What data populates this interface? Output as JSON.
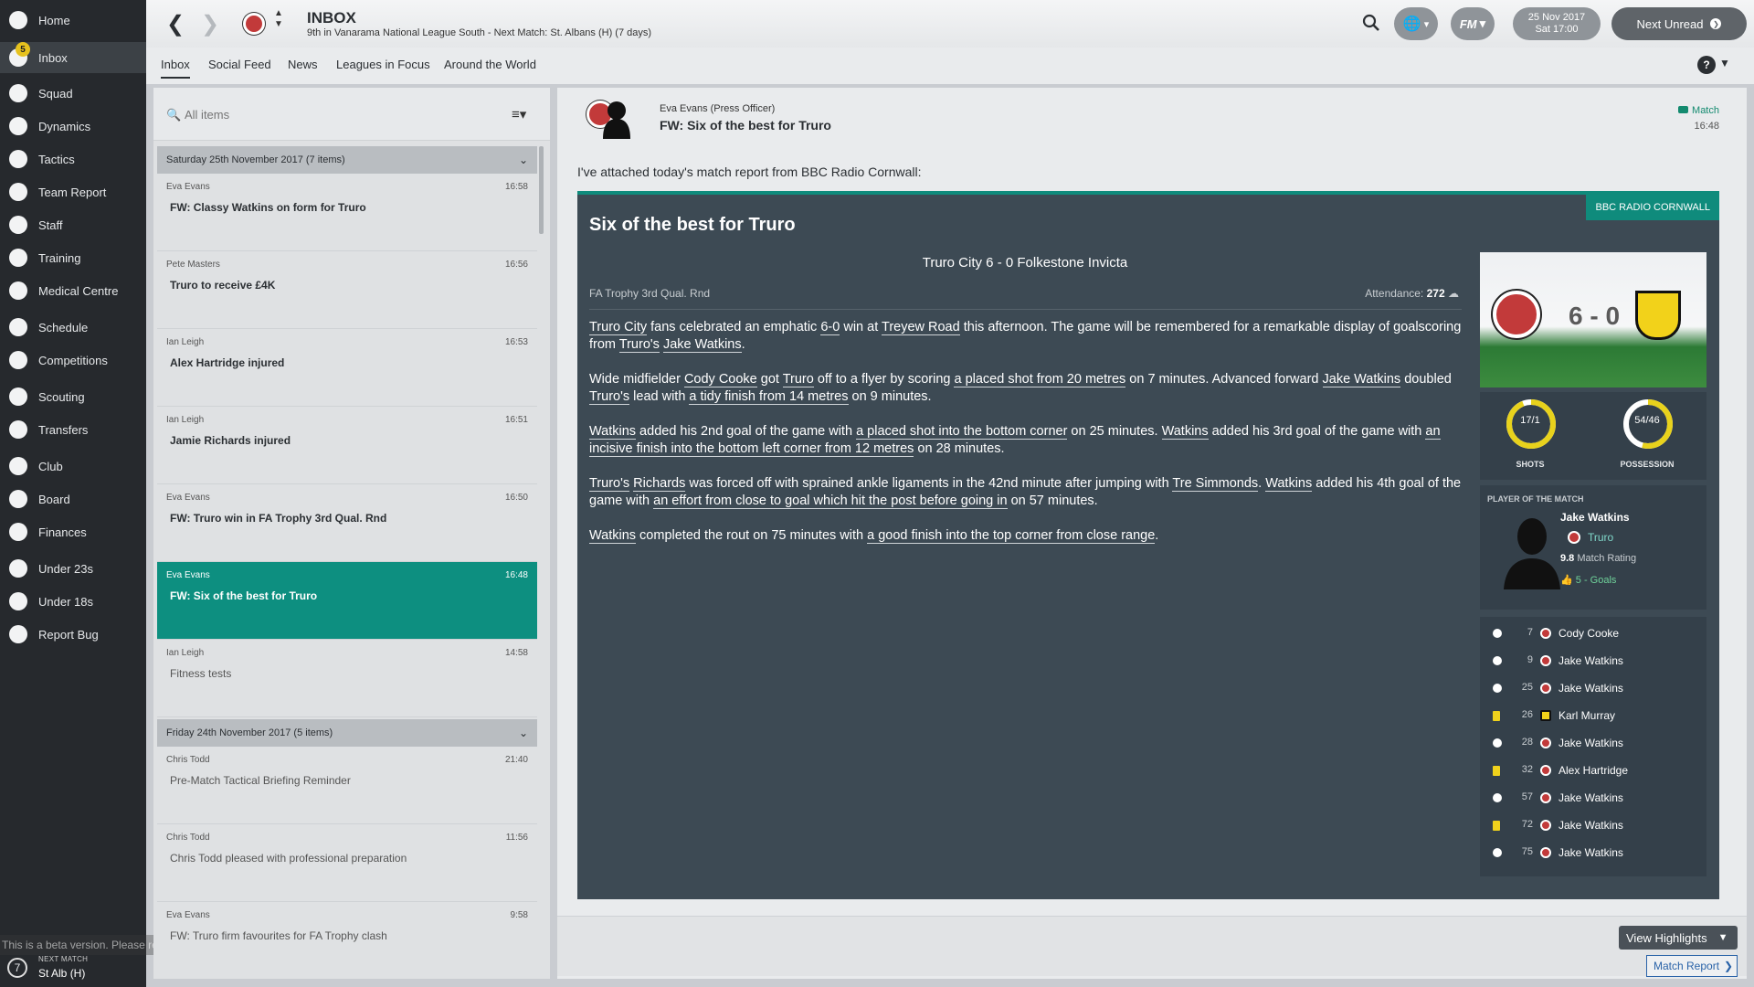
{
  "sidebar": {
    "items": [
      {
        "label": "Home",
        "icon": "home-icon"
      },
      {
        "label": "Inbox",
        "icon": "inbox-icon",
        "badge": "5"
      },
      {
        "label": "Squad",
        "icon": "squad-icon"
      },
      {
        "label": "Dynamics",
        "icon": "dynamics-icon"
      },
      {
        "label": "Tactics",
        "icon": "tactics-icon"
      },
      {
        "label": "Team Report",
        "icon": "team-report-icon"
      },
      {
        "label": "Staff",
        "icon": "staff-icon"
      },
      {
        "label": "Training",
        "icon": "training-icon"
      },
      {
        "label": "Medical Centre",
        "icon": "medical-icon"
      },
      {
        "label": "Schedule",
        "icon": "schedule-icon"
      },
      {
        "label": "Competitions",
        "icon": "trophy-icon"
      },
      {
        "label": "Scouting",
        "icon": "scouting-icon"
      },
      {
        "label": "Transfers",
        "icon": "transfers-icon"
      },
      {
        "label": "Club",
        "icon": "club-icon"
      },
      {
        "label": "Board",
        "icon": "board-icon"
      },
      {
        "label": "Finances",
        "icon": "finances-icon"
      },
      {
        "label": "Under 23s",
        "icon": "u23-icon"
      },
      {
        "label": "Under 18s",
        "icon": "u18-icon"
      },
      {
        "label": "Report Bug",
        "icon": "report-bug-icon"
      }
    ],
    "next_match": {
      "number": "7",
      "label": "NEXT MATCH",
      "value": "St Alb (H)"
    },
    "beta_notice": "This is a beta version. Please report any issues at http://community.sigames.com"
  },
  "topbar": {
    "title": "INBOX",
    "subtitle": "9th in Vanarama National League South - Next Match: St. Albans (H) (7 days)",
    "date": "25 Nov 2017",
    "time": "Sat 17:00",
    "next_unread": "Next Unread",
    "fm_label": "FM"
  },
  "tabs": [
    "Inbox",
    "Social Feed",
    "News",
    "Leagues in Focus",
    "Around the World"
  ],
  "inbox": {
    "search_placeholder": "All items",
    "groups": [
      {
        "header": "Saturday 25th November 2017 (7 items)",
        "messages": [
          {
            "sender": "Eva Evans",
            "time": "16:58",
            "subject": "FW: Classy Watkins on form for Truro",
            "read": false
          },
          {
            "sender": "Pete Masters",
            "time": "16:56",
            "subject": "Truro to receive £4K",
            "read": false
          },
          {
            "sender": "Ian Leigh",
            "time": "16:53",
            "subject": "Alex Hartridge injured",
            "read": false
          },
          {
            "sender": "Ian Leigh",
            "time": "16:51",
            "subject": "Jamie Richards injured",
            "read": false
          },
          {
            "sender": "Eva Evans",
            "time": "16:50",
            "subject": "FW: Truro win in FA Trophy 3rd Qual. Rnd",
            "read": false
          },
          {
            "sender": "Eva Evans",
            "time": "16:48",
            "subject": "FW: Six of the best for Truro",
            "read": false,
            "selected": true
          },
          {
            "sender": "Ian Leigh",
            "time": "14:58",
            "subject": "Fitness tests",
            "read": true
          }
        ]
      },
      {
        "header": "Friday 24th November 2017 (5 items)",
        "messages": [
          {
            "sender": "Chris Todd",
            "time": "21:40",
            "subject": "Pre-Match Tactical Briefing Reminder",
            "read": true
          },
          {
            "sender": "Chris Todd",
            "time": "11:56",
            "subject": "Chris Todd pleased with professional preparation",
            "read": true
          },
          {
            "sender": "Eva Evans",
            "time": "9:58",
            "subject": "FW: Truro firm favourites for FA Trophy clash",
            "read": true
          }
        ]
      }
    ]
  },
  "message": {
    "sender": "Eva Evans  (Press Officer)",
    "subject": "FW: Six of the best for Truro",
    "type": "Match",
    "time": "16:48",
    "intro": "I've attached today's match report from BBC Radio Cornwall:",
    "report": {
      "source": "BBC RADIO CORNWALL",
      "title": "Six of the best for Truro",
      "scoreline": "Truro City  6 - 0   Folkestone Invicta",
      "competition": "FA Trophy 3rd Qual. Rnd",
      "attendance_label": "Attendance:",
      "attendance_value": "272",
      "paragraphs": [
        [
          {
            "t": "Truro City",
            "u": true
          },
          {
            "t": " fans celebrated an emphatic "
          },
          {
            "t": "6-0",
            "u": true
          },
          {
            "t": " win at "
          },
          {
            "t": "Treyew Road",
            "u": true
          },
          {
            "t": " this afternoon. The game will be remembered for a remarkable display of goalscoring from "
          },
          {
            "t": "Truro's",
            "u": true
          },
          {
            "t": " "
          },
          {
            "t": "Jake Watkins",
            "u": true
          },
          {
            "t": "."
          }
        ],
        [
          {
            "t": "Wide midfielder "
          },
          {
            "t": "Cody Cooke",
            "u": true
          },
          {
            "t": " got "
          },
          {
            "t": "Truro",
            "u": true
          },
          {
            "t": " off to a flyer by scoring "
          },
          {
            "t": "a placed shot from 20 metres",
            "u": true
          },
          {
            "t": " on 7 minutes. Advanced forward "
          },
          {
            "t": "Jake Watkins",
            "u": true
          },
          {
            "t": " doubled "
          },
          {
            "t": "Truro's",
            "u": true
          },
          {
            "t": " lead with "
          },
          {
            "t": "a tidy finish from 14 metres",
            "u": true
          },
          {
            "t": " on 9 minutes."
          }
        ],
        [
          {
            "t": "Watkins",
            "u": true
          },
          {
            "t": " added his 2nd goal of the game with "
          },
          {
            "t": "a placed shot into the bottom corner",
            "u": true
          },
          {
            "t": " on 25 minutes. "
          },
          {
            "t": "Watkins",
            "u": true
          },
          {
            "t": " added his 3rd goal of the game with "
          },
          {
            "t": "an incisive finish into the bottom left corner from 12 metres",
            "u": true
          },
          {
            "t": " on 28 minutes."
          }
        ],
        [
          {
            "t": "Truro's",
            "u": true
          },
          {
            "t": " "
          },
          {
            "t": "Richards",
            "u": true
          },
          {
            "t": " was forced off with sprained ankle ligaments in the 42nd minute after jumping with "
          },
          {
            "t": "Tre Simmonds",
            "u": true
          },
          {
            "t": ". "
          },
          {
            "t": "Watkins",
            "u": true
          },
          {
            "t": " added his 4th goal of the game with "
          },
          {
            "t": "an effort from close to goal which hit the post before going in",
            "u": true
          },
          {
            "t": " on 57 minutes."
          }
        ],
        [
          {
            "t": "Watkins",
            "u": true
          },
          {
            "t": " completed the rout on 75 minutes with "
          },
          {
            "t": "a good finish into the top corner from close range",
            "u": true
          },
          {
            "t": "."
          }
        ]
      ],
      "score": "6 - 0",
      "stats": [
        {
          "value": "17/1",
          "label": "SHOTS",
          "fraction": 0.94
        },
        {
          "value": "54/46",
          "label": "POSSESSION",
          "fraction": 0.54
        }
      ],
      "potm": {
        "label": "PLAYER OF THE MATCH",
        "name": "Jake Watkins",
        "club": "Truro",
        "rating": "9.8",
        "rating_label": "Match Rating",
        "goals": "5 - Goals"
      },
      "events": [
        {
          "type": "goal",
          "minute": "7",
          "team": "home",
          "player": "Cody Cooke"
        },
        {
          "type": "goal",
          "minute": "9",
          "team": "home",
          "player": "Jake Watkins"
        },
        {
          "type": "goal",
          "minute": "25",
          "team": "home",
          "player": "Jake Watkins"
        },
        {
          "type": "yellow-card",
          "minute": "26",
          "team": "away",
          "player": "Karl Murray"
        },
        {
          "type": "goal",
          "minute": "28",
          "team": "home",
          "player": "Jake Watkins"
        },
        {
          "type": "yellow-card",
          "minute": "32",
          "team": "home",
          "player": "Alex Hartridge"
        },
        {
          "type": "goal",
          "minute": "57",
          "team": "home",
          "player": "Jake Watkins"
        },
        {
          "type": "yellow-card",
          "minute": "72",
          "team": "home",
          "player": "Jake Watkins"
        },
        {
          "type": "goal",
          "minute": "75",
          "team": "home",
          "player": "Jake Watkins"
        }
      ]
    }
  },
  "actions": {
    "view_highlights": "View Highlights",
    "match_report": "Match Report"
  },
  "colors": {
    "accent": "#0f8b7c",
    "sidebar": "#26292d",
    "report_bg": "#3d4a54",
    "yellow_card": "#f0d21c"
  }
}
